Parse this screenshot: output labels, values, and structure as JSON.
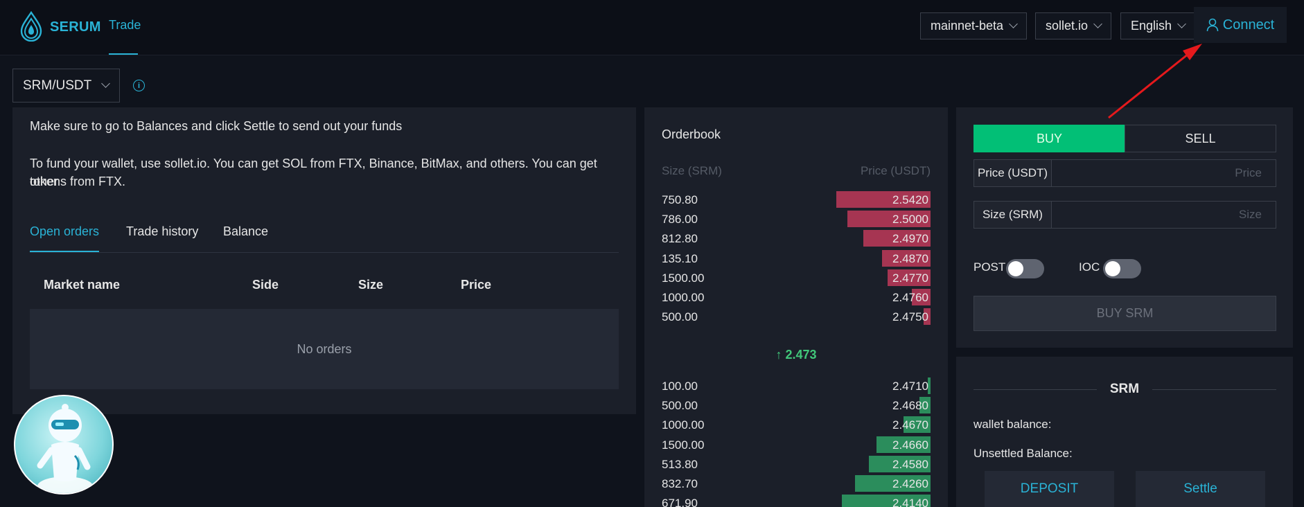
{
  "header": {
    "brand": "SERUM",
    "nav_trade": "Trade",
    "network": "mainnet-beta",
    "wallet_provider": "sollet.io",
    "language": "English",
    "connect_label": "Connect"
  },
  "market": {
    "selected": "SRM/USDT"
  },
  "notices": {
    "settle": "Make sure to go to Balances and click Settle to send out your funds",
    "fund_line1": "To fund your wallet, use sollet.io. You can get SOL from FTX, Binance, BitMax, and others. You can get other",
    "fund_line2": "tokens from FTX."
  },
  "tabs": [
    "Open orders",
    "Trade history",
    "Balance"
  ],
  "orders_table": {
    "columns": [
      "Market name",
      "Side",
      "Size",
      "Price"
    ],
    "empty_text": "No orders"
  },
  "orderbook": {
    "title": "Orderbook",
    "size_header": "Size (SRM)",
    "price_header": "Price (USDT)",
    "asks": [
      {
        "size": "750.80",
        "price": "2.5420",
        "depth": 0.35
      },
      {
        "size": "786.00",
        "price": "2.5000",
        "depth": 0.31
      },
      {
        "size": "812.80",
        "price": "2.4970",
        "depth": 0.25
      },
      {
        "size": "135.10",
        "price": "2.4870",
        "depth": 0.18
      },
      {
        "size": "1500.00",
        "price": "2.4770",
        "depth": 0.16
      },
      {
        "size": "1000.00",
        "price": "2.4760",
        "depth": 0.07
      },
      {
        "size": "500.00",
        "price": "2.4750",
        "depth": 0.025
      }
    ],
    "last_price": "2.473",
    "bids": [
      {
        "size": "100.00",
        "price": "2.4710",
        "depth": 0.01
      },
      {
        "size": "500.00",
        "price": "2.4680",
        "depth": 0.04
      },
      {
        "size": "1000.00",
        "price": "2.4670",
        "depth": 0.1
      },
      {
        "size": "1500.00",
        "price": "2.4660",
        "depth": 0.2
      },
      {
        "size": "513.80",
        "price": "2.4580",
        "depth": 0.23
      },
      {
        "size": "832.70",
        "price": "2.4260",
        "depth": 0.28
      },
      {
        "size": "671.90",
        "price": "2.4140",
        "depth": 0.33
      }
    ],
    "ask_color": "#a63552",
    "bid_color": "#2b8d5c"
  },
  "trade_form": {
    "buy_label": "BUY",
    "sell_label": "SELL",
    "price_label": "Price (USDT)",
    "price_placeholder": "Price",
    "size_label": "Size (SRM)",
    "size_placeholder": "Size",
    "post_label": "POST",
    "ioc_label": "IOC",
    "submit_label": "BUY SRM"
  },
  "balances": {
    "coin": "SRM",
    "wallet_balance_label": "wallet balance:",
    "unsettled_label": "Unsettled Balance:",
    "deposit_label": "DEPOSIT",
    "settle_label": "Settle"
  },
  "colors": {
    "accent": "#2ab3d6",
    "buy": "#02bf76",
    "annotation_arrow": "#e5191c"
  }
}
